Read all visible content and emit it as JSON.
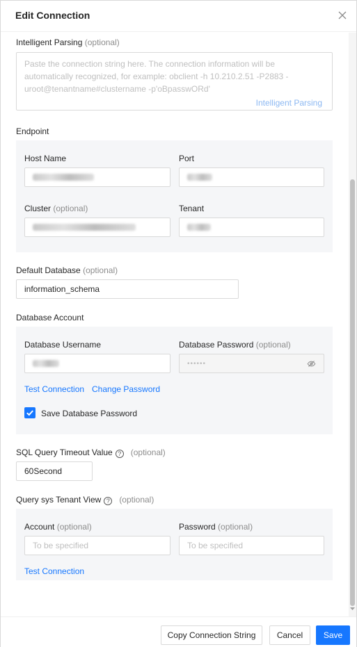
{
  "dialog": {
    "title": "Edit Connection",
    "close_icon": "close-icon"
  },
  "parsing": {
    "label": "Intelligent Parsing",
    "optional": "(optional)",
    "placeholder": "Paste the connection string here. The connection information will be automatically recognized, for example: obclient -h 10.210.2.51 -P2883 -uroot@tenantname#clustername -p'oBpasswORd'",
    "action": "Intelligent Parsing"
  },
  "endpoint": {
    "section_label": "Endpoint",
    "host_label": "Host Name",
    "port_label": "Port",
    "cluster_label": "Cluster",
    "cluster_optional": "(optional)",
    "tenant_label": "Tenant"
  },
  "default_db": {
    "label": "Default Database",
    "optional": "(optional)",
    "value": "information_schema"
  },
  "account": {
    "section_label": "Database Account",
    "username_label": "Database Username",
    "password_label": "Database Password",
    "password_optional": "(optional)",
    "password_mask": "••••••",
    "eye_icon": "eye-slash-icon",
    "test_connection": "Test Connection",
    "change_password": "Change Password",
    "save_password_label": "Save Database Password",
    "save_password_checked": true
  },
  "timeout": {
    "label": "SQL Query Timeout Value",
    "optional": "(optional)",
    "value": "60Second"
  },
  "sys_tenant": {
    "label": "Query sys Tenant View",
    "optional": "(optional)",
    "account_label": "Account",
    "account_optional": "(optional)",
    "account_placeholder": "To be specified",
    "password_label": "Password",
    "password_optional": "(optional)",
    "password_placeholder": "To be specified",
    "test_connection": "Test Connection"
  },
  "footer": {
    "copy_label": "Copy Connection String",
    "cancel_label": "Cancel",
    "save_label": "Save"
  },
  "colors": {
    "primary": "#1677ff",
    "panel_bg": "#f5f6f8",
    "border": "#d9d9d9"
  }
}
